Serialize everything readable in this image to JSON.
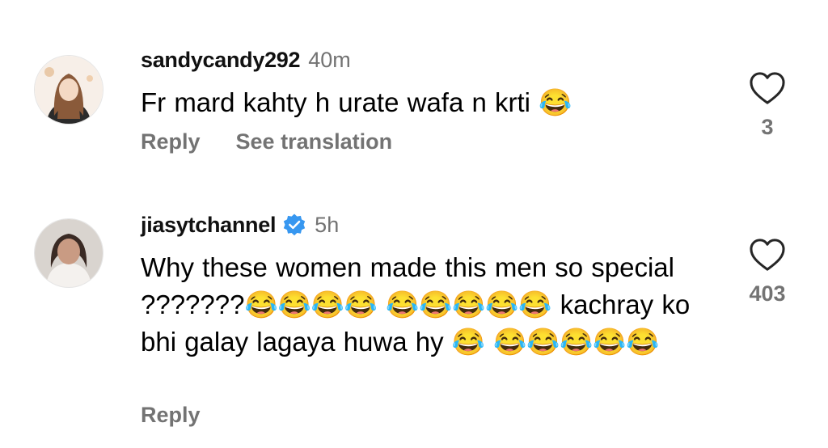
{
  "comments": [
    {
      "username": "sandycandy292",
      "time": "40m",
      "text": "Fr mard kahty h urate wafa n krti 😂",
      "likes": "3",
      "actions": [
        "Reply",
        "See translation"
      ],
      "verified": false
    },
    {
      "username": "jiasytchannel",
      "time": "5h",
      "text": "Why these women made this men so special ???????😂😂😂😂 😂😂😂😂😂 kachray ko bhi galay lagaya huwa hy 😂 😂😂😂😂😂",
      "likes": "403",
      "actions": [
        "Reply"
      ],
      "verified": true
    }
  ],
  "colors": {
    "secondary_text": "#737373",
    "verified_badge": "#3797f0"
  },
  "icons": {
    "like": "heart-outline-icon",
    "verified": "verified-badge-icon"
  }
}
